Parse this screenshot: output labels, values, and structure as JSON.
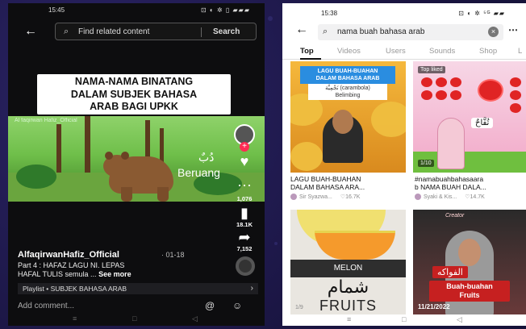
{
  "left": {
    "status": {
      "time": "15:45",
      "icons": "⊡ ◐ ✲ ▯ ▰▰▰"
    },
    "search": {
      "placeholder": "Find related content",
      "button": "Search"
    },
    "caption": [
      "NAMA-NAMA BINATANG",
      "DALAM SUBJEK BAHASA",
      "ARAB BAGI UPKK"
    ],
    "scene": {
      "watermark": "Al faqirwan Hafiz_Official",
      "arabic_word": "دُبٌ",
      "label": "Beruang"
    },
    "rail": {
      "comment_count": "1,076",
      "save_count": "18.1K",
      "share_count": "7,152"
    },
    "author": "AlfaqirwanHafiz_Official",
    "date": "· 01-18",
    "description_line1": "Part 4 : HAFAZ LAGU NI. LEPAS",
    "description_line2": "HAFAL TULIS semula ...",
    "see_more": "See more",
    "playlist": "Playlist • SUBJEK BAHASA ARAB",
    "comment_placeholder": "Add comment...",
    "nav": [
      "≡",
      "□",
      "◁"
    ]
  },
  "right": {
    "status": {
      "time": "15:38",
      "icons": "⊡ ◐ ✲ ⁵ᴳ ▰▰"
    },
    "search_value": "nama buah bahasa arab",
    "tabs": [
      "Top",
      "Videos",
      "Users",
      "Sounds",
      "Shop",
      "L"
    ],
    "cards": [
      {
        "overlay_title": [
          "LAGU BUAH-BUAHAN",
          "DALAM BAHASA ARAB"
        ],
        "overlay_sub": [
          "نَجْمِيَّة (carambola)",
          "Belimbing"
        ],
        "caption": [
          "LAGU BUAH-BUAHAN",
          "DALAM BAHASA ARA..."
        ],
        "author": "Sir Syazwa...",
        "likes": "♡16.7K"
      },
      {
        "overlay_label": "Top liked",
        "arabic_word": "تُفَّاحٌ",
        "counter": "1/10",
        "caption": [
          "#namabuahbahasaara",
          "b NAMA BUAH DALA..."
        ],
        "author": "Syaki & Kis...",
        "likes": "♡14.7K"
      },
      {
        "band": "MELON",
        "arabic_word": "شمام",
        "bottom_word": "FRUITS",
        "counter": "1/9"
      },
      {
        "top_text": "Creator",
        "arabic_word": "الفواكه",
        "label": [
          "Buah-buahan",
          "Fruits"
        ],
        "date": "11/21/2022"
      }
    ],
    "nav": [
      "≡",
      "□",
      "◁"
    ]
  },
  "icons": {
    "back": "back-arrow-icon",
    "search": "search-icon",
    "clear": "clear-icon",
    "more": "more-icon",
    "heart": "heart-icon",
    "comment": "comment-icon",
    "bookmark": "bookmark-icon",
    "share": "share-icon"
  }
}
